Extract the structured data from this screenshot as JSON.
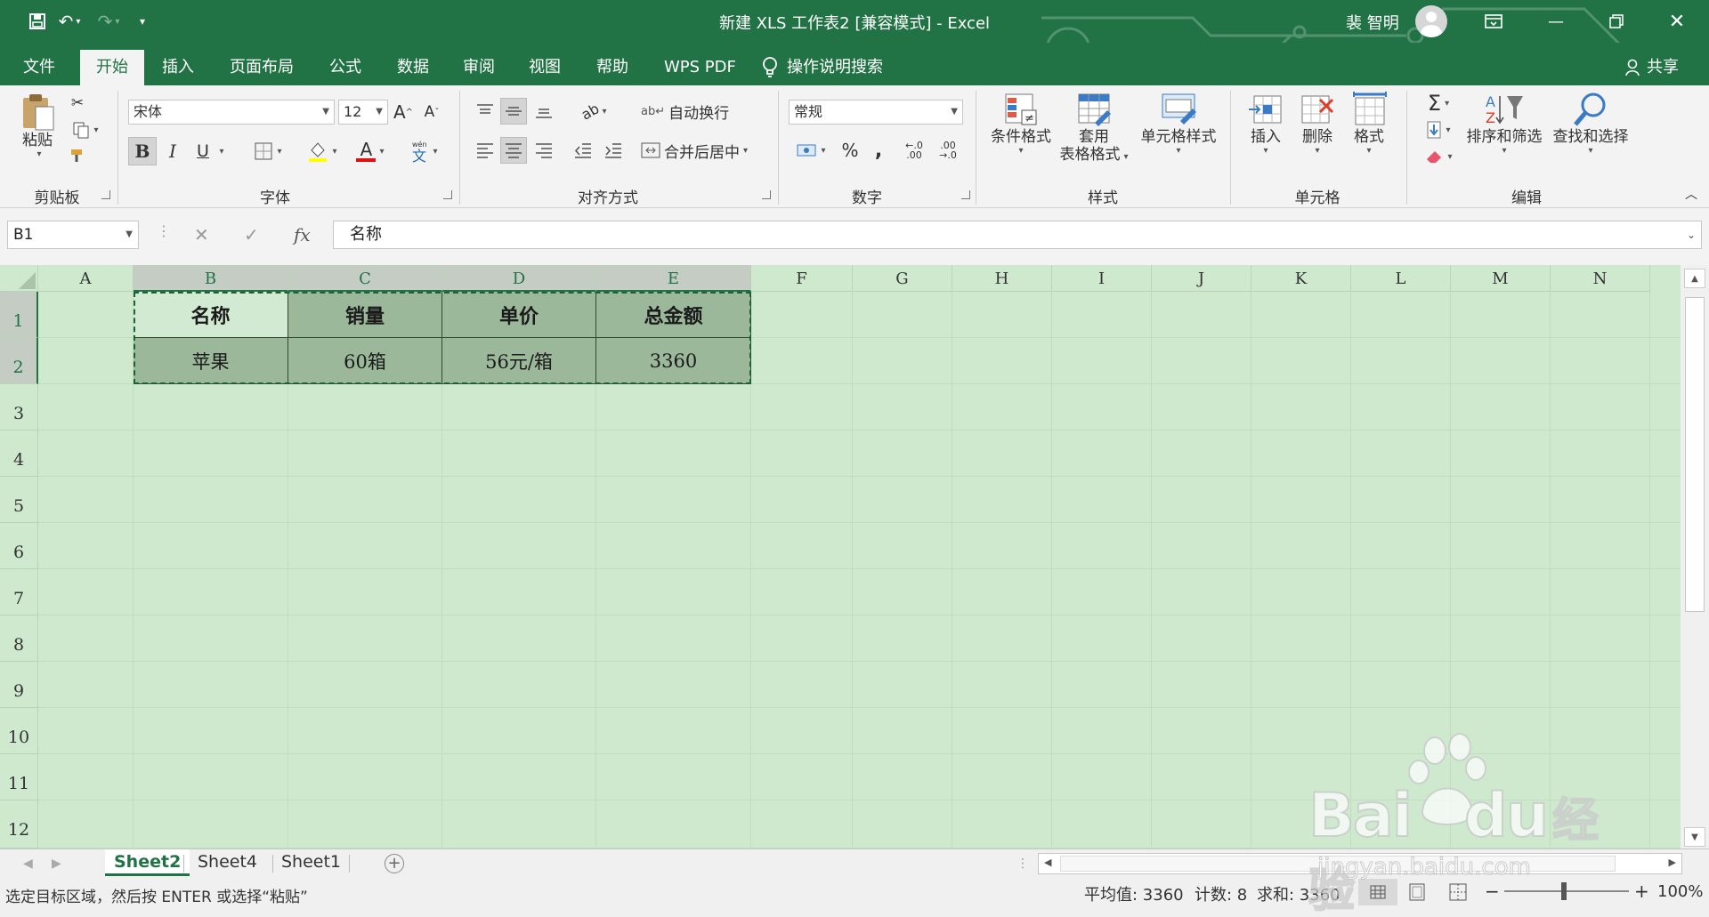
{
  "titlebar": {
    "doc_title": "新建 XLS 工作表2 [兼容模式] - Excel",
    "user": "裴 智明"
  },
  "tabs": [
    "文件",
    "开始",
    "插入",
    "页面布局",
    "公式",
    "数据",
    "审阅",
    "视图",
    "帮助",
    "WPS PDF"
  ],
  "tell_me": "操作说明搜索",
  "share": "共享",
  "ribbon": {
    "clipboard": {
      "paste": "粘贴",
      "label": "剪贴板"
    },
    "font": {
      "name": "宋体",
      "size": "12",
      "bold": "B",
      "italic": "I",
      "underline": "U",
      "font_color": "A",
      "label": "字体"
    },
    "alignment": {
      "wrap_text": "自动换行",
      "merge_center": "合并后居中",
      "label": "对齐方式"
    },
    "number": {
      "format": "常规",
      "percent": "%",
      "comma": ",",
      "label": "数字"
    },
    "styles": {
      "conditional": "条件格式",
      "table_1": "套用",
      "table_2": "表格格式",
      "cell_styles": "单元格样式",
      "label": "样式"
    },
    "cells": {
      "insert": "插入",
      "delete": "删除",
      "format": "格式",
      "label": "单元格"
    },
    "editing": {
      "sort_filter": "排序和筛选",
      "find_select": "查找和选择",
      "label": "编辑"
    }
  },
  "formula_bar": {
    "name_box": "B1",
    "fx": "fx",
    "content": "名称"
  },
  "columns": [
    "A",
    "B",
    "C",
    "D",
    "E",
    "F",
    "G",
    "H",
    "I",
    "J",
    "K",
    "L",
    "M",
    "N"
  ],
  "rows": [
    "1",
    "2",
    "3",
    "4",
    "5",
    "6",
    "7",
    "8",
    "9",
    "10",
    "11",
    "12"
  ],
  "table": {
    "header": [
      "名称",
      "销量",
      "单价",
      "总金额"
    ],
    "row": [
      "苹果",
      "60箱",
      "56元/箱",
      "3360"
    ]
  },
  "sheets": [
    "Sheet2",
    "Sheet4",
    "Sheet1"
  ],
  "status": {
    "message": "选定目标区域，然后按 ENTER 或选择“粘贴”",
    "average": "平均值: 3360",
    "count": "计数: 8",
    "sum": "求和: 3360",
    "zoom": "100%"
  },
  "watermark": {
    "brand": "Bai",
    "brand2": "du",
    "cn": "经验",
    "url": "jingyan.baidu.com"
  },
  "colors": {
    "excel_green": "#217346",
    "grid_bg": "#cfe9cf",
    "selection": "#9bb89b"
  }
}
